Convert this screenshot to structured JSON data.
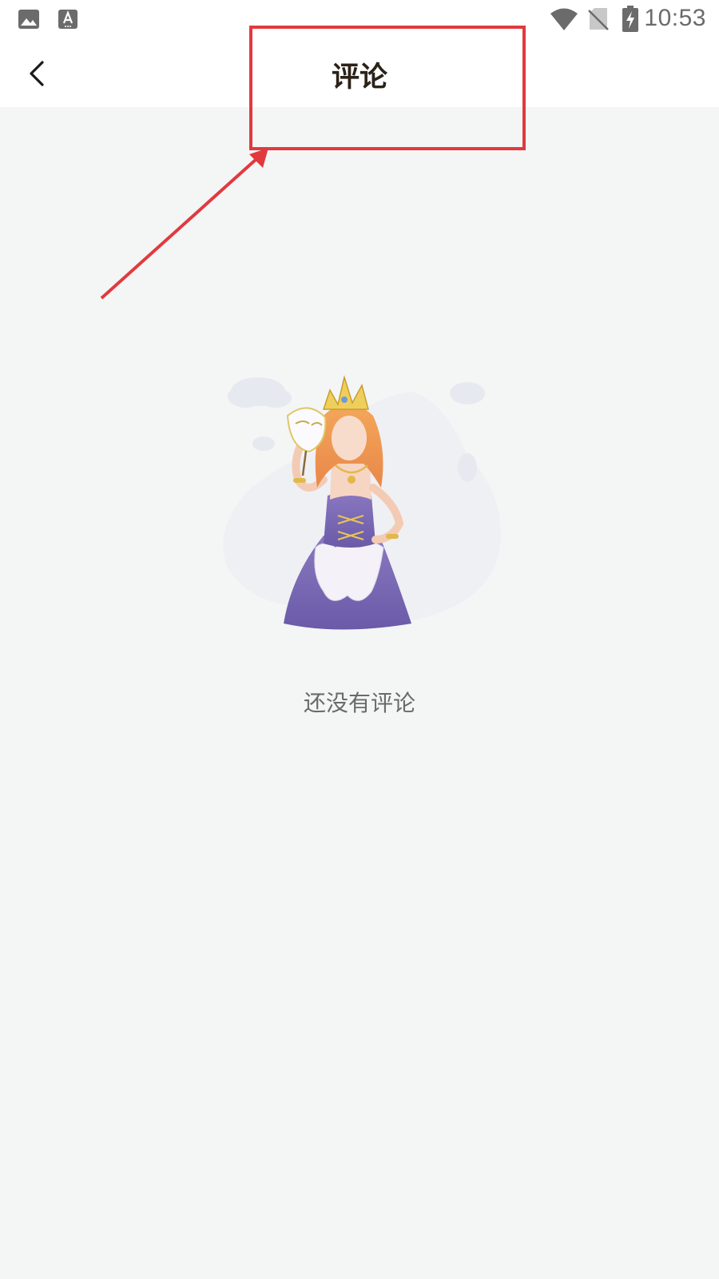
{
  "status_bar": {
    "time": "10:53",
    "left_icons": [
      "image-icon",
      "text-input-icon"
    ],
    "right_icons": [
      "wifi-icon",
      "no-sim-icon",
      "battery-charging-icon"
    ]
  },
  "header": {
    "title": "评论",
    "back_icon": "chevron-left-icon"
  },
  "empty_state": {
    "message": "还没有评论",
    "illustration": "princess-with-mask-illustration"
  },
  "colors": {
    "page_background": "#f4f5f5",
    "header_background": "#ffffff",
    "title_text": "#2b2218",
    "empty_text": "#6a6a6a",
    "annotation_red": "#e03a3e"
  }
}
